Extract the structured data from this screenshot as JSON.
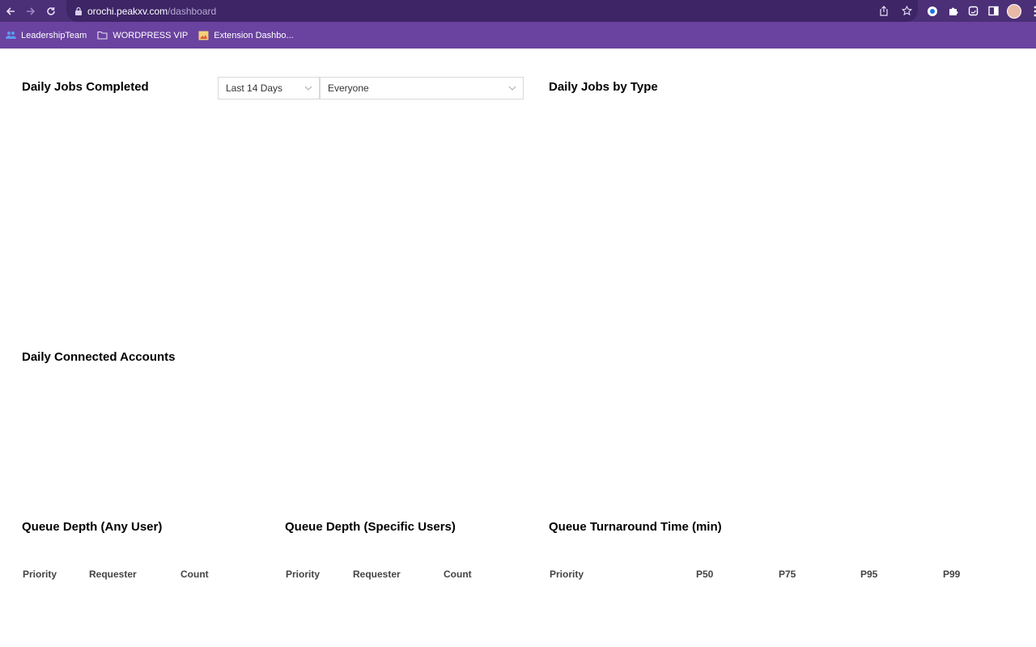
{
  "browser": {
    "url_domain": "orochi.peakxv.com",
    "url_path": "/dashboard",
    "bookmarks": [
      {
        "label": "LeadershipTeam"
      },
      {
        "label": "WORDPRESS VIP"
      },
      {
        "label": "Extension Dashbo..."
      }
    ]
  },
  "dashboard": {
    "daily_jobs_completed": {
      "title": "Daily Jobs Completed",
      "range_select": "Last 14 Days",
      "user_select": "Everyone"
    },
    "daily_jobs_by_type": {
      "title": "Daily Jobs by Type"
    },
    "daily_connected_accounts": {
      "title": "Daily Connected Accounts"
    },
    "queue_depth_any": {
      "title": "Queue Depth (Any User)",
      "columns": [
        "Priority",
        "Requester",
        "Count"
      ]
    },
    "queue_depth_specific": {
      "title": "Queue Depth (Specific Users)",
      "columns": [
        "Priority",
        "Requester",
        "Count"
      ]
    },
    "queue_turnaround": {
      "title": "Queue Turnaround Time (min)",
      "columns": [
        "Priority",
        "P50",
        "P75",
        "P95",
        "P99"
      ]
    }
  }
}
